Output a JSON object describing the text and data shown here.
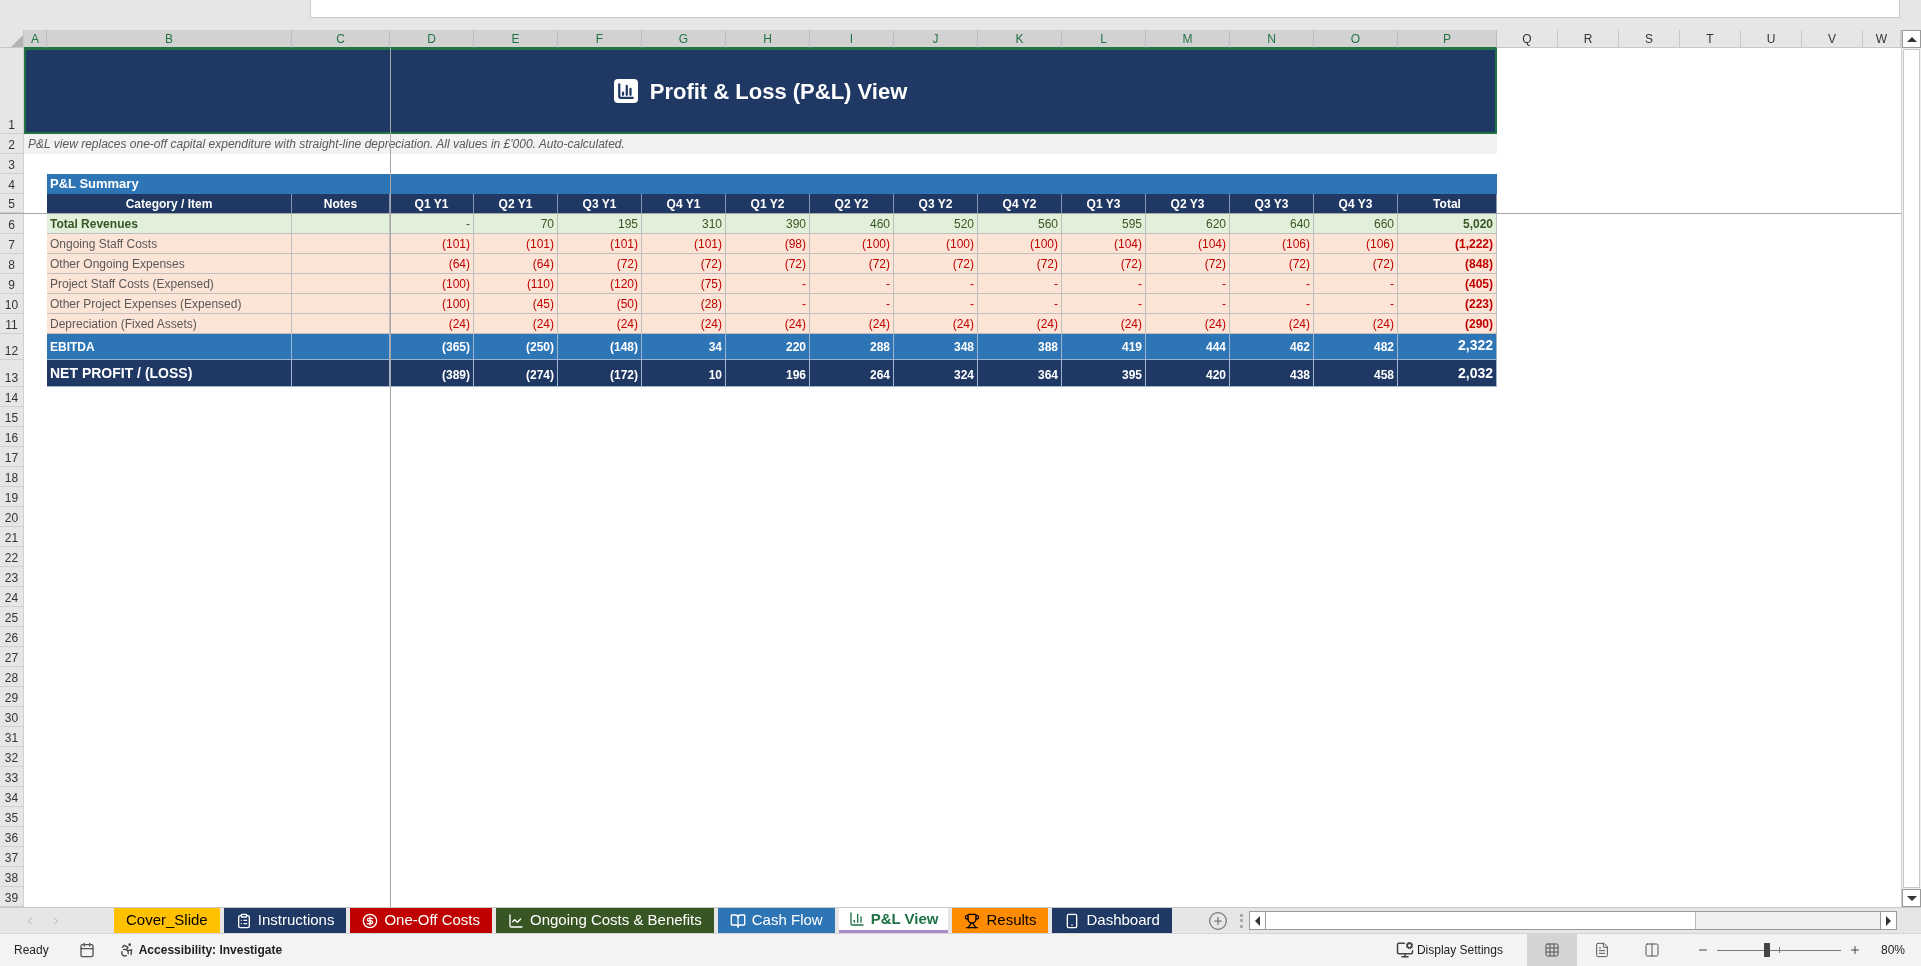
{
  "column_headers": [
    {
      "label": "A",
      "selected": true
    },
    {
      "label": "B",
      "selected": true
    },
    {
      "label": "C",
      "selected": true
    },
    {
      "label": "D",
      "selected": true
    },
    {
      "label": "E",
      "selected": true
    },
    {
      "label": "F",
      "selected": true
    },
    {
      "label": "G",
      "selected": true
    },
    {
      "label": "H",
      "selected": true
    },
    {
      "label": "I",
      "selected": true
    },
    {
      "label": "J",
      "selected": true
    },
    {
      "label": "K",
      "selected": true
    },
    {
      "label": "L",
      "selected": true
    },
    {
      "label": "M",
      "selected": true
    },
    {
      "label": "N",
      "selected": true
    },
    {
      "label": "O",
      "selected": true
    },
    {
      "label": "P",
      "selected": true
    },
    {
      "label": "Q",
      "selected": false
    },
    {
      "label": "R",
      "selected": false
    },
    {
      "label": "S",
      "selected": false
    },
    {
      "label": "T",
      "selected": false
    },
    {
      "label": "U",
      "selected": false
    },
    {
      "label": "V",
      "selected": false
    },
    {
      "label": "W",
      "selected": false
    }
  ],
  "row_numbers": [
    "1",
    "2",
    "3",
    "4",
    "5",
    "6",
    "7",
    "8",
    "9",
    "10",
    "11",
    "12",
    "13",
    "14",
    "15",
    "16",
    "17",
    "18",
    "19",
    "20",
    "21",
    "22",
    "23",
    "24",
    "25",
    "26",
    "27",
    "28",
    "29",
    "30",
    "31",
    "32",
    "33",
    "34",
    "35",
    "36",
    "37",
    "38",
    "39"
  ],
  "title": "Profit & Loss (P&L) View",
  "note": "P&L view replaces one-off capital expenditure with straight-line depreciation. All values in £'000. Auto-calculated.",
  "section_title": "P&L Summary",
  "table": {
    "columns": [
      "Category / Item",
      "Notes",
      "Q1 Y1",
      "Q2 Y1",
      "Q3 Y1",
      "Q4 Y1",
      "Q1 Y2",
      "Q2 Y2",
      "Q3 Y2",
      "Q4 Y2",
      "Q1 Y3",
      "Q2 Y3",
      "Q3 Y3",
      "Q4 Y3",
      "Total"
    ],
    "rows": [
      {
        "kind": "revenue",
        "label": "Total Revenues",
        "values": [
          "-",
          "70",
          "195",
          "310",
          "390",
          "460",
          "520",
          "560",
          "595",
          "620",
          "640",
          "660"
        ],
        "total": "5,020"
      },
      {
        "kind": "expense",
        "label": "Ongoing Staff Costs",
        "values": [
          "(101)",
          "(101)",
          "(101)",
          "(101)",
          "(98)",
          "(100)",
          "(100)",
          "(100)",
          "(104)",
          "(104)",
          "(106)",
          "(106)"
        ],
        "total": "(1,222)"
      },
      {
        "kind": "expense",
        "label": "Other Ongoing Expenses",
        "values": [
          "(64)",
          "(64)",
          "(72)",
          "(72)",
          "(72)",
          "(72)",
          "(72)",
          "(72)",
          "(72)",
          "(72)",
          "(72)",
          "(72)"
        ],
        "total": "(848)"
      },
      {
        "kind": "expense",
        "label": "Project Staff Costs (Expensed)",
        "values": [
          "(100)",
          "(110)",
          "(120)",
          "(75)",
          "-",
          "-",
          "-",
          "-",
          "-",
          "-",
          "-",
          "-"
        ],
        "total": "(405)"
      },
      {
        "kind": "expense",
        "label": "Other Project Expenses (Expensed)",
        "values": [
          "(100)",
          "(45)",
          "(50)",
          "(28)",
          "-",
          "-",
          "-",
          "-",
          "-",
          "-",
          "-",
          "-"
        ],
        "total": "(223)"
      },
      {
        "kind": "expense",
        "label": "Depreciation (Fixed Assets)",
        "values": [
          "(24)",
          "(24)",
          "(24)",
          "(24)",
          "(24)",
          "(24)",
          "(24)",
          "(24)",
          "(24)",
          "(24)",
          "(24)",
          "(24)"
        ],
        "total": "(290)"
      },
      {
        "kind": "ebitda",
        "label": "EBITDA",
        "values": [
          "(365)",
          "(250)",
          "(148)",
          "34",
          "220",
          "288",
          "348",
          "388",
          "419",
          "444",
          "462",
          "482"
        ],
        "total": "2,322"
      },
      {
        "kind": "net",
        "label": "NET PROFIT / (LOSS)",
        "values": [
          "(389)",
          "(274)",
          "(172)",
          "10",
          "196",
          "264",
          "324",
          "364",
          "395",
          "420",
          "438",
          "458"
        ],
        "total": "2,032"
      }
    ]
  },
  "sheet_tabs": [
    {
      "label": "Cover_Slide",
      "color": "#ffc000",
      "selected": false
    },
    {
      "label": "Instructions",
      "color": "#1f3864",
      "selected": false
    },
    {
      "label": "One-Off Costs",
      "color": "#c00000",
      "selected": false
    },
    {
      "label": "Ongoing Costs & Benefits",
      "color": "#375623",
      "selected": false
    },
    {
      "label": "Cash Flow",
      "color": "#2e75b6",
      "selected": false
    },
    {
      "label": "P&L View",
      "color": "#1e7145",
      "selected": true
    },
    {
      "label": "Results",
      "color": "#ff8c00",
      "selected": false
    },
    {
      "label": "Dashboard",
      "color": "#1f3864",
      "selected": false
    }
  ],
  "status_bar": {
    "ready": "Ready",
    "accessibility": "Accessibility: Investigate",
    "display_settings": "Display Settings",
    "view_buttons": [
      {
        "selected": true
      },
      {
        "selected": false
      },
      {
        "selected": false
      }
    ],
    "zoom": {
      "level": 0.4,
      "reading": "80%"
    }
  }
}
